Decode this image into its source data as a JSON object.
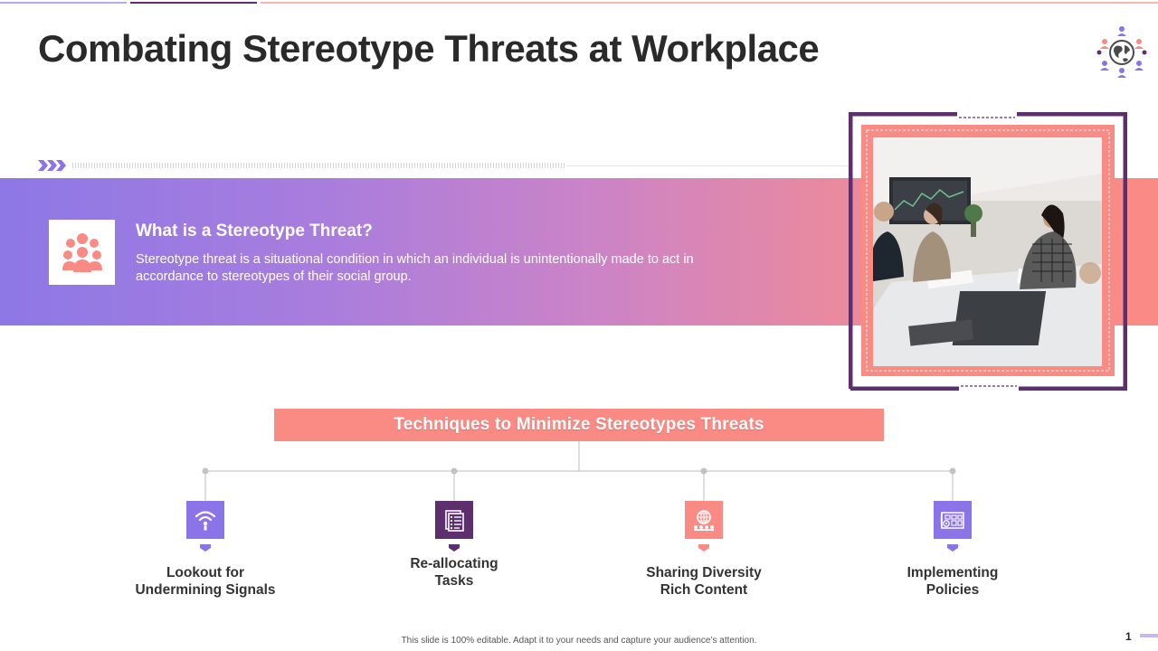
{
  "slide": {
    "title": "Combating Stereotype Threats at Workplace",
    "page_number": "1",
    "footer": "This slide is 100% editable.  Adapt it to your needs and capture your audience’s attention."
  },
  "definition": {
    "heading": "What is a Stereotype  Threat?",
    "text": "Stereotype threat is a situational condition in which an individual is unintentionally  made to act in accordance to stereotypes of their social group.",
    "icon": "group-people-icon"
  },
  "photo": {
    "subject": "office-meeting-photo"
  },
  "techniques": {
    "heading": "Techniques to Minimize Stereotypes Threats",
    "items": [
      {
        "label_line1": "Lookout for",
        "label_line2": "Undermining Signals",
        "icon": "signal-icon",
        "color": "#8a74e8"
      },
      {
        "label_line1": "Re-allocating",
        "label_line2": "Tasks",
        "icon": "task-list-icon",
        "color": "#5d2f6e"
      },
      {
        "label_line1": "Sharing Diversity",
        "label_line2": "Rich Content",
        "icon": "globe-network-icon",
        "color": "#fa8a84"
      },
      {
        "label_line1": "Implementing",
        "label_line2": "Policies",
        "icon": "policy-blueprint-icon",
        "color": "#8a74e8"
      }
    ]
  },
  "colors": {
    "purple_light": "#8a74e8",
    "purple_dark": "#5d2f6e",
    "coral": "#fa8a84"
  }
}
